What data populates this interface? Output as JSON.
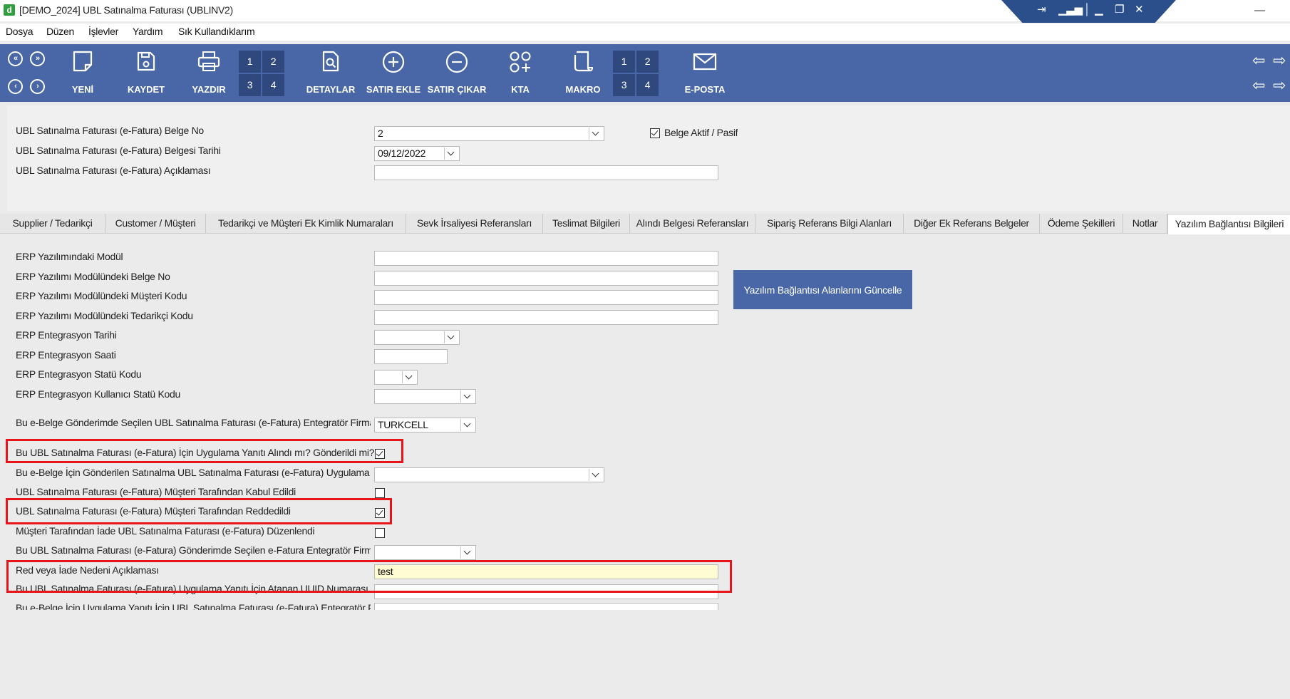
{
  "window": {
    "title": "[DEMO_2024] UBL Satınalma Faturası (UBLINV2)",
    "app_icon_letter": "d",
    "minimize_glyph": "—"
  },
  "menu": [
    "Dosya",
    "Düzen",
    "İşlevler",
    "Yardım",
    "Sık Kullandıklarım"
  ],
  "toolbar": {
    "buttons": [
      {
        "label": "YENİ",
        "icon": "new-document-icon"
      },
      {
        "label": "KAYDET",
        "icon": "save-icon"
      },
      {
        "label": "YAZDIR",
        "icon": "printer-icon"
      },
      {
        "label": "DETAYLAR",
        "icon": "details-icon"
      },
      {
        "label": "SATIR EKLE",
        "icon": "plus-circle-icon"
      },
      {
        "label": "SATIR ÇIKAR",
        "icon": "minus-circle-icon"
      },
      {
        "label": "KTA",
        "icon": "apps-icon"
      },
      {
        "label": "MAKRO",
        "icon": "scroll-icon"
      },
      {
        "label": "E-POSTA",
        "icon": "envelope-icon"
      }
    ],
    "numgrid1": [
      "1",
      "2",
      "3",
      "4"
    ],
    "numgrid2": [
      "1",
      "2",
      "3",
      "4"
    ]
  },
  "header": {
    "belge_no_label": "UBL Satınalma Faturası (e-Fatura) Belge No",
    "belge_no_value": "2",
    "tarih_label": "UBL Satınalma Faturası (e-Fatura) Belgesi Tarihi",
    "tarih_value": "09/12/2022",
    "aciklama_label": "UBL Satınalma Faturası (e-Fatura) Açıklaması",
    "aciklama_value": "",
    "aktif_label": "Belge Aktif / Pasif",
    "aktif_checked": true
  },
  "tabs": [
    "Supplier / Tedarikçi",
    "Customer / Müşteri",
    "Tedarikçi ve Müşteri Ek Kimlik Numaraları",
    "Sevk İrsaliyesi Referansları",
    "Teslimat Bilgileri",
    "Alındı Belgesi Referansları",
    "Sipariş Referans Bilgi Alanları",
    "Diğer Ek Referans Belgeler",
    "Ödeme Şekilleri",
    "Notlar",
    "Yazılım Bağlantısı Bilgileri"
  ],
  "active_tab": "Yazılım Bağlantısı Bilgileri",
  "form": {
    "erp_modul": "ERP Yazılımındaki Modül",
    "erp_belge_no": "ERP Yazılımı Modülündeki Belge No",
    "erp_musteri_kodu": "ERP Yazılımı Modülündeki Müşteri Kodu",
    "erp_tedarikci_kodu": "ERP Yazılımı Modülündeki Tedarikçi Kodu",
    "erp_ent_tarihi": "ERP Entegrasyon Tarihi",
    "erp_ent_saati": "ERP Entegrasyon Saati",
    "erp_ent_statu": "ERP Entegrasyon Statü Kodu",
    "erp_ent_kullanici_statu": "ERP Entegrasyon Kullanıcı Statü Kodu",
    "entegrator_label": "Bu e-Belge Gönderimde Seçilen UBL Satınalma Faturası (e-Fatura) Entegratör Firması",
    "entegrator_value": "TURKCELL",
    "uygulama_yaniti": "Bu UBL Satınalma Faturası (e-Fatura) İçin Uygulama Yanıtı Alındı mı? Gönderildi mi?",
    "uygulama_yaniti_checked": true,
    "gonderilen_label": "Bu e-Belge İçin Gönderilen Satınalma UBL Satınalma Faturası (e-Fatura) Uygulama Yanıtı",
    "kabul_label": "UBL Satınalma Faturası (e-Fatura) Müşteri Tarafından Kabul Edildi",
    "kabul_checked": false,
    "red_label": "UBL Satınalma Faturası (e-Fatura) Müşteri Tarafından Reddedildi",
    "red_checked": true,
    "iade_label": "Müşteri Tarafından İade UBL Satınalma Faturası (e-Fatura) Düzenlendi",
    "iade_checked": false,
    "efatura_entegrator_label": "Bu UBL Satınalma Faturası (e-Fatura) Gönderimde Seçilen e-Fatura Entegratör Firması",
    "red_neden_label": "Red veya İade Nedeni Açıklaması",
    "red_neden_value": "test",
    "uuid_label": "Bu UBL Satınalma Faturası (e-Fatura) Uygulama Yanıtı İçin Atanan UUID Numarası",
    "last_label": "Bu e-Belge İçin Uygulama Yanıtı İçin UBL Satınalma Faturası (e-Fatura) Entegratör Firması",
    "update_button": "Yazılım Bağlantısı Alanlarını Güncelle"
  },
  "colors": {
    "toolbar_bg": "#4967a7",
    "numcell_bg": "#2f487d",
    "highlight_red": "#e8141a",
    "input_yellow": "#fffbd3"
  }
}
